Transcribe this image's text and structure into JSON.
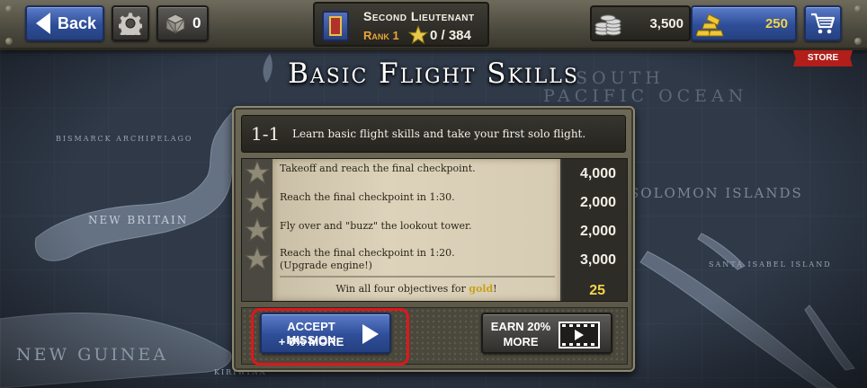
{
  "map": {
    "labels": [
      "Bismarck Archipelago",
      "New Britain",
      "New Guinea",
      "Kiriwina",
      "South",
      "Pacific Ocean",
      "Solomon Islands",
      "Santa Isabel Island"
    ]
  },
  "topbar": {
    "back_label": "Back",
    "settings_icon": "gear-icon",
    "crate_count": "0",
    "rank_title": "Second Lieutenant",
    "rank_level": "Rank 1",
    "rank_stars": "0 / 384",
    "silver_amount": "3,500",
    "gold_amount": "250",
    "store_label": "STORE"
  },
  "mission": {
    "title": "Basic Flight Skills",
    "id": "1-1",
    "description": "Learn basic flight skills and take your first solo flight.",
    "objectives": [
      {
        "text": "Takeoff and reach the final checkpoint.",
        "note": "",
        "score": "4,000"
      },
      {
        "text": "Reach the final checkpoint in 1:30.",
        "note": "",
        "score": "2,000"
      },
      {
        "text": "Fly over and \"buzz\" the lookout tower.",
        "note": "",
        "score": "2,000"
      },
      {
        "text": "Reach the final checkpoint in 1:20.",
        "note": "(Upgrade engine!)",
        "score": "3,000"
      }
    ],
    "gold_prefix": "Win all four objectives for ",
    "gold_word": "gold",
    "gold_suffix": "!",
    "gold_reward": "25"
  },
  "buttons": {
    "accept_line1": "ACCEPT MISSION",
    "accept_line2": "+ 0% MORE",
    "earn_line1": "EARN 20%",
    "earn_line2": "MORE"
  },
  "colors": {
    "accent_blue": "#2f4e98",
    "gold_text": "#f2d54a",
    "highlight_red": "#e0161c",
    "store_red": "#b21e1a"
  }
}
